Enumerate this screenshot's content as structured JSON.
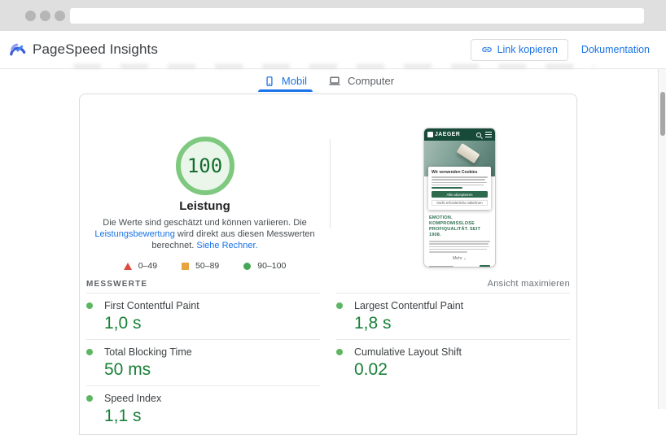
{
  "browser": {
    "url_value": ""
  },
  "header": {
    "app_title": "PageSpeed Insights",
    "copy_link_label": "Link kopieren",
    "documentation_label": "Dokumentation"
  },
  "tabs": [
    {
      "label": "Mobil",
      "active": true
    },
    {
      "label": "Computer",
      "active": false
    }
  ],
  "report": {
    "score": "100",
    "category_label": "Leistung",
    "disclaimer_prefix": "Die Werte sind geschätzt und können variieren. Die ",
    "disclaimer_link1": "Leistungsbewertung",
    "disclaimer_middle": " wird direkt aus diesen Messwerten berechnet. ",
    "disclaimer_link2": "Siehe Rechner.",
    "legend": [
      {
        "shape": "triangle",
        "color": "#dc4b3e",
        "range": "0–49"
      },
      {
        "shape": "square",
        "color": "#e8a33d",
        "range": "50–89"
      },
      {
        "shape": "circle",
        "color": "#46a758",
        "range": "90–100"
      }
    ]
  },
  "metrics_section": {
    "heading": "MESSWERTE",
    "expand_label": "Ansicht maximieren",
    "metrics": [
      {
        "label": "First Contentful Paint",
        "value": "1,0 s",
        "status": "pass"
      },
      {
        "label": "Largest Contentful Paint",
        "value": "1,8 s",
        "status": "pass"
      },
      {
        "label": "Total Blocking Time",
        "value": "50 ms",
        "status": "pass"
      },
      {
        "label": "Cumulative Layout Shift",
        "value": "0.02",
        "status": "pass"
      },
      {
        "label": "Speed Index",
        "value": "1,1 s",
        "status": "pass"
      }
    ]
  },
  "thumbnail": {
    "site_name": "JAEGER",
    "cookie_title": "Wir verwenden Cookies",
    "cookie_accept": "Alle akzeptieren",
    "cookie_decline": "Nicht erforderliche ablehnen",
    "hero_heading_1": "EMOTION.",
    "hero_heading_2": "KOMPROMISSLOSE PROFIQUALITÄT. SEIT 1908.",
    "more_label": "Mehr ⌄"
  },
  "colors": {
    "accent_blue": "#1a73e8",
    "score_value_green": "#156d2e",
    "score_ring_green": "#7ec97f",
    "metric_value_green": "#188038",
    "legend_red": "#dc4b3e",
    "legend_orange": "#e8a33d",
    "legend_green": "#46a758",
    "thumb_header_green": "#184a39",
    "thumb_button_green": "#2d6a4e"
  }
}
